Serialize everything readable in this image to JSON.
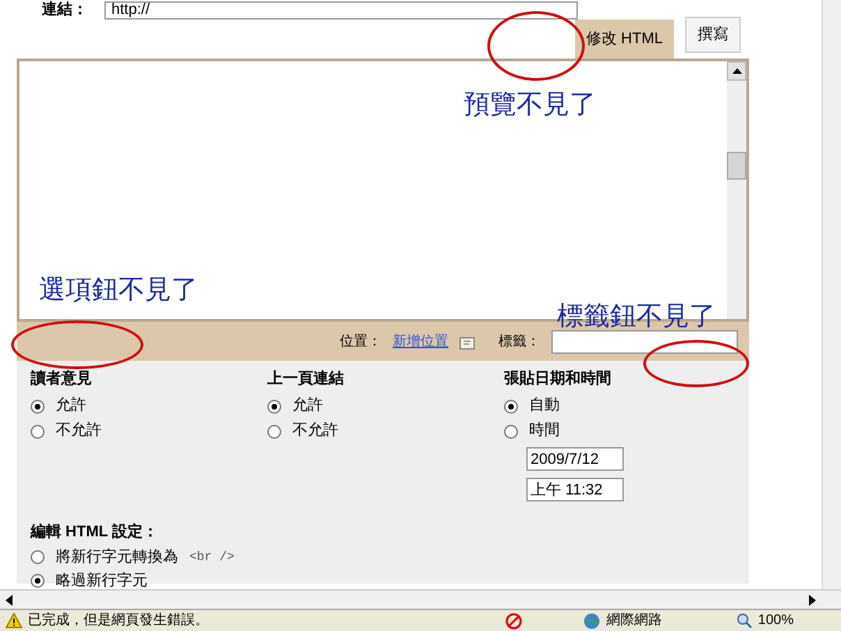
{
  "link_field": {
    "label": "連結：",
    "value": "http://"
  },
  "tabs": [
    {
      "label": "修改 HTML",
      "selected": true
    },
    {
      "label": "撰寫",
      "selected": false
    }
  ],
  "annotations": [
    {
      "text": "預覽不見了"
    },
    {
      "text": "選項鈕不見了"
    },
    {
      "text": "標籤鈕不見了"
    }
  ],
  "toolbar": {
    "location_label": "位置：",
    "location_link": "新增位置",
    "labels_label": "標籤："
  },
  "options": [
    {
      "title": "讀者意見",
      "choices": [
        {
          "label": "允許",
          "selected": true
        },
        {
          "label": "不允許",
          "selected": false
        }
      ]
    },
    {
      "title": "上一頁連結",
      "choices": [
        {
          "label": "允許",
          "selected": true
        },
        {
          "label": "不允許",
          "selected": false
        }
      ]
    },
    {
      "title": "張貼日期和時間",
      "choices": [
        {
          "label": "自動",
          "selected": true
        },
        {
          "label": "時間",
          "selected": false
        }
      ],
      "date": "2009/7/12",
      "time": "上午 11:32"
    }
  ],
  "html_settings": {
    "title": "編輯 HTML 設定：",
    "choices": [
      {
        "label": "將新行字元轉換為",
        "code": "<br />",
        "selected": false
      },
      {
        "label": "略過新行字元",
        "selected": true
      }
    ]
  },
  "status_bar": {
    "message": "已完成，但是網頁發生錯誤。",
    "zone": "網際網路",
    "zoom": "100%"
  }
}
